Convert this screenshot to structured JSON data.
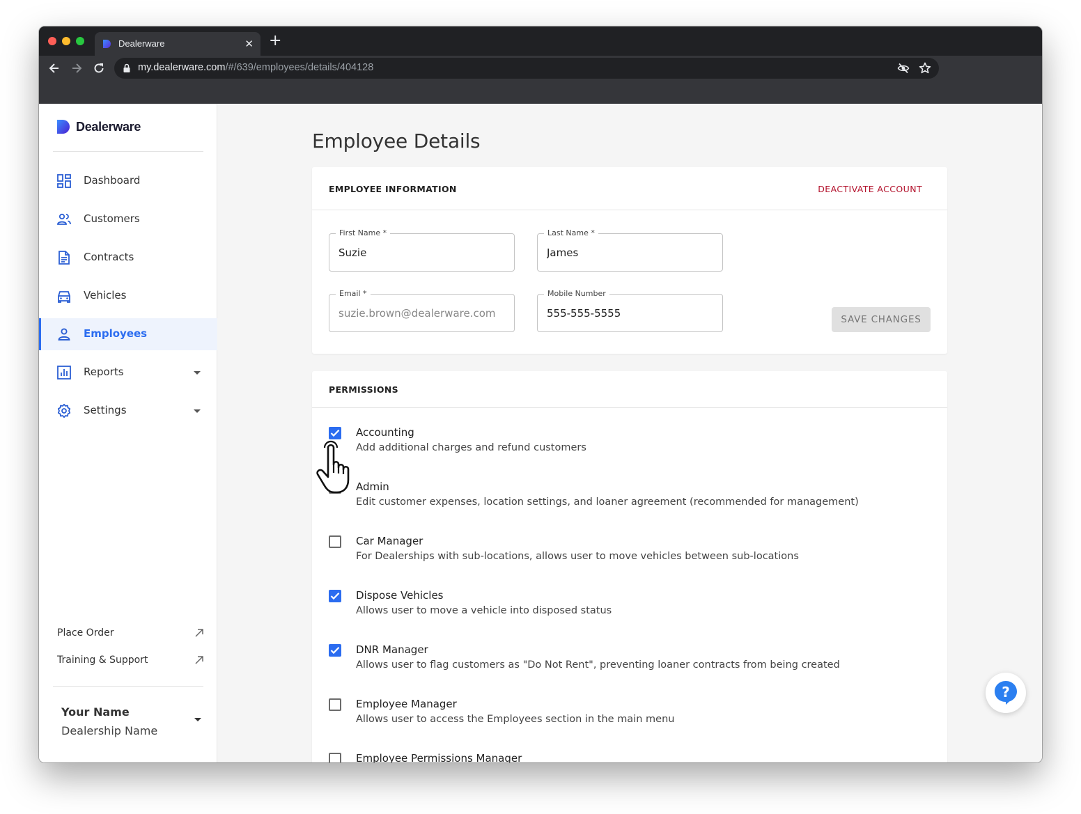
{
  "browser": {
    "tab_title": "Dealerware",
    "url_host": "my.dealerware.com",
    "url_path": "/#/639/employees/details/404128"
  },
  "sidebar": {
    "brand": "Dealerware",
    "items": [
      {
        "label": "Dashboard",
        "icon": "dashboard-icon"
      },
      {
        "label": "Customers",
        "icon": "customers-icon"
      },
      {
        "label": "Contracts",
        "icon": "contracts-icon"
      },
      {
        "label": "Vehicles",
        "icon": "vehicles-icon"
      },
      {
        "label": "Employees",
        "icon": "employees-icon",
        "active": true
      },
      {
        "label": "Reports",
        "icon": "reports-icon",
        "expandable": true
      },
      {
        "label": "Settings",
        "icon": "settings-icon",
        "expandable": true
      }
    ],
    "links": [
      {
        "label": "Place Order"
      },
      {
        "label": "Training & Support"
      }
    ],
    "user": {
      "name": "Your Name",
      "dealership": "Dealership Name"
    }
  },
  "main": {
    "page_title": "Employee Details",
    "info_card": {
      "title": "EMPLOYEE INFORMATION",
      "deactivate_label": "DEACTIVATE ACCOUNT",
      "first_name": {
        "label": "First Name *",
        "value": "Suzie"
      },
      "last_name": {
        "label": "Last Name *",
        "value": "James"
      },
      "email": {
        "label": "Email *",
        "value": "suzie.brown@dealerware.com"
      },
      "mobile": {
        "label": "Mobile Number",
        "value": "555-555-5555"
      },
      "save_label": "SAVE CHANGES"
    },
    "permissions_card": {
      "title": "PERMISSIONS",
      "items": [
        {
          "title": "Accounting",
          "desc": "Add additional charges and refund customers",
          "checked": true
        },
        {
          "title": "Admin",
          "desc": "Edit customer expenses, location settings, and loaner agreement (recommended for management)",
          "checked": false
        },
        {
          "title": "Car Manager",
          "desc": "For Dealerships with sub-locations, allows user to move vehicles between sub-locations",
          "checked": false
        },
        {
          "title": "Dispose Vehicles",
          "desc": "Allows user to move a vehicle into disposed status",
          "checked": true
        },
        {
          "title": "DNR Manager",
          "desc": "Allows user to flag customers as \"Do Not Rent\", preventing loaner contracts from being created",
          "checked": true
        },
        {
          "title": "Employee Manager",
          "desc": "Allows user to access the Employees section in the main menu",
          "checked": false
        },
        {
          "title": "Employee Permissions Manager",
          "desc": "",
          "checked": false
        }
      ]
    }
  },
  "colors": {
    "accent": "#2b6cf0",
    "danger": "#b3122c",
    "sidebar_active_bg": "#eef3fd"
  }
}
